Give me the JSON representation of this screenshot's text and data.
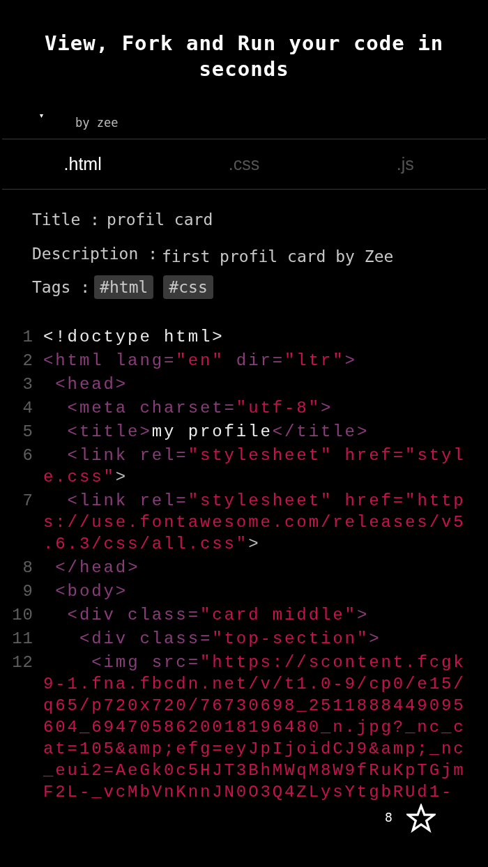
{
  "header": {
    "title": "View, Fork and Run your code in seconds",
    "caret": "▾",
    "author": "by zee"
  },
  "tabs": [
    {
      "label": ".html",
      "selected": true
    },
    {
      "label": ".css",
      "selected": false
    },
    {
      "label": ".js",
      "selected": false
    }
  ],
  "info": {
    "title_label": "Title :",
    "title": "profil card",
    "description_label": "Description :",
    "description": "first profil card by Zee",
    "tags_label": "Tags :",
    "tags": [
      "#html",
      "#css"
    ]
  },
  "code": [
    {
      "number": "1",
      "rows": [
        [
          {
            "kind": "text",
            "text": "<!doctype html>"
          }
        ]
      ]
    },
    {
      "number": "2",
      "rows": [
        [
          {
            "kind": "tag",
            "text": "<html lang="
          },
          {
            "kind": "string",
            "text": "\"en\""
          },
          {
            "kind": "tag",
            "text": " dir="
          },
          {
            "kind": "string",
            "text": "\"ltr\""
          },
          {
            "kind": "tag",
            "text": ">"
          }
        ]
      ]
    },
    {
      "number": "3",
      "rows": [
        [
          {
            "kind": "tag",
            "text": " <head>"
          }
        ]
      ]
    },
    {
      "number": "4",
      "rows": [
        [
          {
            "kind": "tag",
            "text": "  <meta charset="
          },
          {
            "kind": "string",
            "text": "\"utf-8\""
          },
          {
            "kind": "tag",
            "text": ">"
          }
        ]
      ]
    },
    {
      "number": "5",
      "rows": [
        [
          {
            "kind": "tag",
            "text": "  <title>"
          },
          {
            "kind": "text",
            "text": "my profile"
          },
          {
            "kind": "tag",
            "text": "</title>"
          }
        ]
      ]
    },
    {
      "number": "6",
      "rows": [
        [
          {
            "kind": "tag",
            "text": "  <link rel="
          },
          {
            "kind": "string",
            "text": "\"stylesheet\" href=\"style.css\""
          },
          {
            "kind": "punct",
            "text": ">"
          }
        ]
      ]
    },
    {
      "number": "7",
      "rows": [
        [
          {
            "kind": "tag",
            "text": "  <link rel="
          },
          {
            "kind": "string",
            "text": "\"stylesheet\" href=\"https://use.fontawesome.com/releases/v5.6.3/css/all.css\""
          },
          {
            "kind": "punct",
            "text": ">"
          }
        ]
      ]
    },
    {
      "number": "8",
      "rows": [
        [
          {
            "kind": "tag",
            "text": " </head>"
          }
        ]
      ]
    },
    {
      "number": "9",
      "rows": [
        [
          {
            "kind": "tag",
            "text": " <body>"
          }
        ]
      ]
    },
    {
      "number": "10",
      "rows": [
        [
          {
            "kind": "tag",
            "text": "  <div class="
          },
          {
            "kind": "string",
            "text": "\"card middle\""
          },
          {
            "kind": "tag",
            "text": ">"
          }
        ]
      ]
    },
    {
      "number": "11",
      "rows": [
        [
          {
            "kind": "tag",
            "text": "   <div class="
          },
          {
            "kind": "string",
            "text": "\"top-section\""
          },
          {
            "kind": "tag",
            "text": ">"
          }
        ]
      ]
    },
    {
      "number": "12",
      "rows": [
        [
          {
            "kind": "tag",
            "text": "    <img src="
          },
          {
            "kind": "string",
            "text": "\"https://scontent.fcgk9-1.fna.fbcdn.net/v/t1.0-9/cp0/e15/q65/p720x720/76730698_2511888449095604_6947058620018196480_n.jpg?_nc_cat=105&amp;efg=eyJpIjoidCJ9&amp;_nc_eui2=AeGk0c5HJT3BhMWqM8W9fRuKpTGjmF2L-_vcMbVnKnnJN0O3Q4ZLysYtgbRUd1-"
          }
        ]
      ]
    }
  ],
  "star": {
    "count": "8"
  }
}
